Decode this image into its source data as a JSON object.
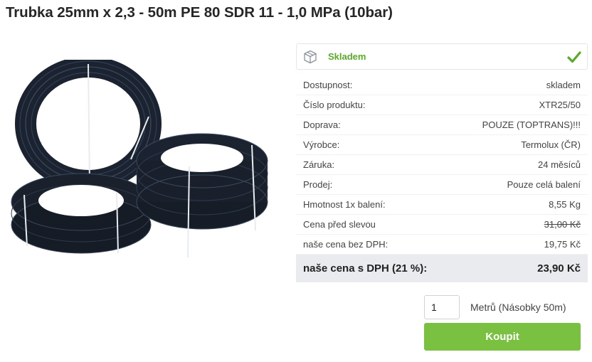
{
  "product": {
    "title": "Trubka 25mm x 2,3 - 50m PE 80 SDR 11 - 1,0 MPa (10bar)",
    "image_icon": "pipe-coils-image"
  },
  "availability": {
    "label": "Skladem",
    "box_icon": "box-icon",
    "status_icon": "check-icon",
    "status_color": "#5aaa2a"
  },
  "params": [
    {
      "label": "Dostupnost:",
      "value": "skladem"
    },
    {
      "label": "Číslo produktu:",
      "value": "XTR25/50"
    },
    {
      "label": "Doprava:",
      "value": "POUZE (TOPTRANS)!!!"
    },
    {
      "label": "Výrobce:",
      "value": "Termolux (ČR)"
    },
    {
      "label": "Záruka:",
      "value": "24 měsíců"
    },
    {
      "label": "Prodej:",
      "value": "Pouze celá balení"
    },
    {
      "label": "Hmotnost 1x balení:",
      "value": "8,55 Kg"
    },
    {
      "label": "Cena před slevou",
      "value": "31,00 Kč"
    },
    {
      "label": "naše cena bez DPH:",
      "value": "19,75 Kč"
    }
  ],
  "final_price": {
    "label": "naše cena s DPH (21 %):",
    "value": "23,90 Kč"
  },
  "purchase": {
    "quantity": "1",
    "unit_label": "Metrů (Násobky 50m)",
    "buy_label": "Koupit",
    "buy_color": "#7ac142"
  }
}
